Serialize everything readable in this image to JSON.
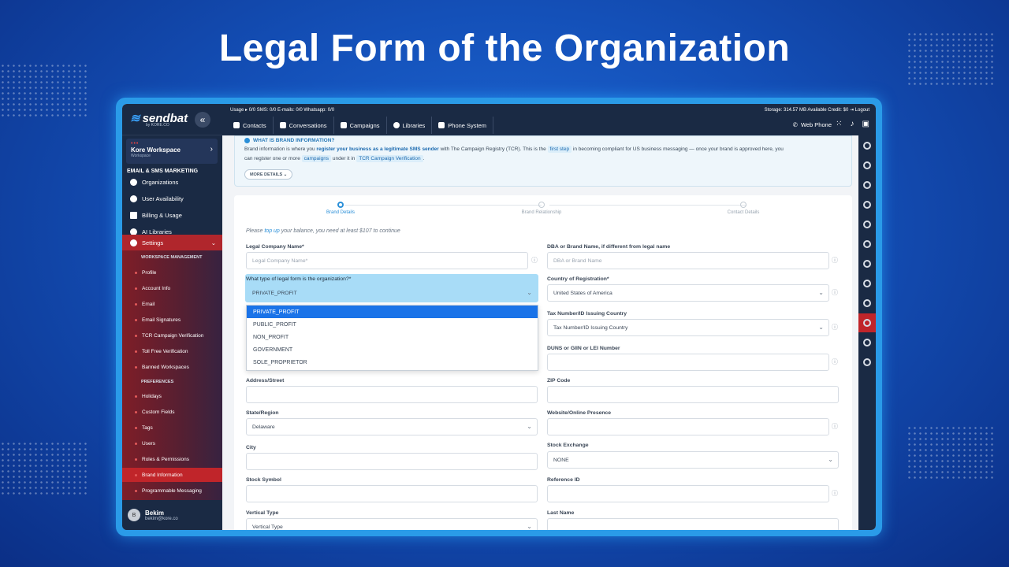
{
  "slide_title": "Legal Form of the Organization",
  "logo": {
    "name": "sendbat",
    "sub": "by KORE.CO"
  },
  "workspace": {
    "name": "Kore Workspace",
    "sub": "Workspace"
  },
  "sidebar": {
    "section": "EMAIL & SMS MARKETING",
    "items": [
      {
        "label": "Organizations"
      },
      {
        "label": "User Availability"
      },
      {
        "label": "Billing & Usage"
      },
      {
        "label": "AI Libraries"
      },
      {
        "label": "Settings"
      }
    ],
    "ws_mgmt": "WORKSPACE MANAGEMENT",
    "subitems": [
      {
        "label": "Profile"
      },
      {
        "label": "Account Info"
      },
      {
        "label": "Email"
      },
      {
        "label": "Email Signatures"
      },
      {
        "label": "TCR Campaign Verification"
      },
      {
        "label": "Toll Free Verification"
      },
      {
        "label": "Banned Workspaces"
      }
    ],
    "prefs": "PREFERENCES",
    "prefitems": [
      {
        "label": "Holidays"
      },
      {
        "label": "Custom Fields"
      },
      {
        "label": "Tags"
      },
      {
        "label": "Users"
      },
      {
        "label": "Roles & Permissions"
      },
      {
        "label": "Brand Information"
      },
      {
        "label": "Programmable Messaging"
      }
    ]
  },
  "user": {
    "initial": "B",
    "name": "Bekim",
    "email": "bekim@kore.co"
  },
  "topbar": {
    "usage": "Usage ▸ 0/0  SMS: 0/0  E-mails: 0/0  Whatsapp: 0/0",
    "storage": "Storage: 314.57 MB  Available Credit: $0  ⇥ Logout",
    "tabs": [
      {
        "label": "Contacts"
      },
      {
        "label": "Conversations"
      },
      {
        "label": "Campaigns"
      },
      {
        "label": "Libraries"
      },
      {
        "label": "Phone System"
      }
    ],
    "webphone": "Web Phone"
  },
  "info": {
    "heading": "WHAT IS BRAND INFORMATION?",
    "t1": "Brand information is where you",
    "t2": "register your business as a legitimate SMS sender",
    "t3": "with The Campaign Registry (TCR). This is the",
    "t4": "first step",
    "t5": "in becoming compliant for US business messaging — once your brand is approved here, you",
    "t6": "can register one or more",
    "t7": "campaigns",
    "t8": "under it in",
    "t9": "TCR Campaign Verification",
    "t10": ".",
    "more": "MORE DETAILS ⌄"
  },
  "steps": [
    {
      "label": "Brand Details"
    },
    {
      "label": "Brand Relationship"
    },
    {
      "label": "Contact Details"
    }
  ],
  "note": {
    "a": "Please",
    "b": "top up",
    "c": "your balance, you need at least $107 to continue"
  },
  "form": {
    "legal_name_label": "Legal Company Name*",
    "legal_name_ph": "Legal Company Name*",
    "dba_label": "DBA or Brand Name, if different from legal name",
    "dba_ph": "DBA or Brand Name",
    "legal_form_label": "What type of legal form is the organization?*",
    "legal_form_value": "PRIVATE_PROFIT",
    "country_label": "Country of Registration*",
    "country_value": "United States of America",
    "tax_label": "Tax Number/ID Issuing Country",
    "tax_value": "Tax Number/ID Issuing Country",
    "duns_label": "DUNS or GIIN or LEI Number",
    "address_label": "Address/Street",
    "zip_label": "ZIP Code",
    "state_label": "State/Region",
    "state_value": "Delaware",
    "website_label": "Website/Online Presence",
    "city_label": "City",
    "stockex_label": "Stock Exchange",
    "stockex_value": "NONE",
    "symbol_label": "Stock Symbol",
    "ref_label": "Reference ID",
    "vertical_label": "Vertical Type",
    "vertical_value": "Vertical Type",
    "last_label": "Last Name"
  },
  "dropdown": {
    "options": [
      "PRIVATE_PROFIT",
      "PUBLIC_PROFIT",
      "NON_PROFIT",
      "GOVERNMENT",
      "SOLE_PROPRIETOR"
    ],
    "selected": "PRIVATE_PROFIT"
  },
  "colors": {
    "accent": "#2a8fd8",
    "sidebar": "#1a2a44",
    "active": "#c0252a",
    "selected_option": "#1a73e8"
  }
}
